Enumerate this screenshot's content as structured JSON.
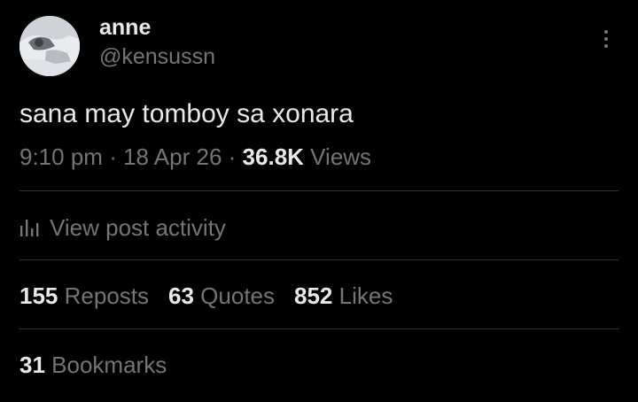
{
  "author": {
    "display_name": "anne",
    "handle": "@kensussn",
    "avatar_icon": "avatar-photo"
  },
  "more_icon": "more-vertical-icon",
  "tweet": {
    "text": "sana may tomboy sa xonara"
  },
  "meta": {
    "time": "9:10 pm",
    "separator": "·",
    "date": "18 Apr 26",
    "views_count": "36.8K",
    "views_label": "Views"
  },
  "activity": {
    "icon": "analytics-icon",
    "label": "View post activity"
  },
  "stats": {
    "reposts_count": "155",
    "reposts_label": "Reposts",
    "quotes_count": "63",
    "quotes_label": "Quotes",
    "likes_count": "852",
    "likes_label": "Likes",
    "bookmarks_count": "31",
    "bookmarks_label": "Bookmarks"
  },
  "colors": {
    "background": "#000000",
    "primary_text": "#e7e9ea",
    "secondary_text": "#71767b",
    "divider": "#2f3336"
  }
}
